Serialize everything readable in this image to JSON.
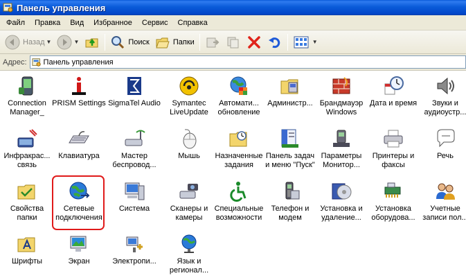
{
  "window": {
    "title": "Панель управления"
  },
  "menu": {
    "items": [
      "Файл",
      "Правка",
      "Вид",
      "Избранное",
      "Сервис",
      "Справка"
    ]
  },
  "toolbar": {
    "back_label": "Назад",
    "search_label": "Поиск",
    "folders_label": "Папки"
  },
  "address": {
    "label": "Адрес:",
    "value": "Панель управления"
  },
  "items": [
    {
      "label": "Connection Manager_",
      "icon": "pda-icon"
    },
    {
      "label": "PRISM Settings",
      "icon": "info-icon"
    },
    {
      "label": "SigmaTel Audio",
      "icon": "sigmatel-icon"
    },
    {
      "label": "Symantec LiveUpdate",
      "icon": "liveupdate-icon"
    },
    {
      "label": "Автомати... обновление",
      "icon": "globe-update-icon"
    },
    {
      "label": "Администр...",
      "icon": "admin-tools-icon"
    },
    {
      "label": "Брандмауэр Windows",
      "icon": "firewall-icon"
    },
    {
      "label": "Дата и время",
      "icon": "clock-icon"
    },
    {
      "label": "Звуки и аудиоустр...",
      "icon": "speaker-icon"
    },
    {
      "label": "Инфракрас... связь",
      "icon": "infrared-icon"
    },
    {
      "label": "Клавиатура",
      "icon": "keyboard-icon"
    },
    {
      "label": "Мастер беспровод...",
      "icon": "wireless-icon"
    },
    {
      "label": "Мышь",
      "icon": "mouse-icon"
    },
    {
      "label": "Назначенные задания",
      "icon": "scheduled-tasks-icon"
    },
    {
      "label": "Панель задач и меню \"Пуск\"",
      "icon": "taskbar-icon"
    },
    {
      "label": "Параметры Монитор...",
      "icon": "phone-modem-icon"
    },
    {
      "label": "Принтеры и факсы",
      "icon": "printer-icon"
    },
    {
      "label": "Речь",
      "icon": "speech-icon"
    },
    {
      "label": "Свойства папки",
      "icon": "folder-options-icon"
    },
    {
      "label": "Сетевые подключения",
      "icon": "network-globe-icon"
    },
    {
      "label": "Система",
      "icon": "system-icon"
    },
    {
      "label": "Сканеры и камеры",
      "icon": "scanner-icon"
    },
    {
      "label": "Специальные возможности",
      "icon": "accessibility-icon"
    },
    {
      "label": "Телефон и модем",
      "icon": "telephone-icon"
    },
    {
      "label": "Установка и удаление...",
      "icon": "add-remove-icon"
    },
    {
      "label": "Установка оборудова...",
      "icon": "hardware-icon"
    },
    {
      "label": "Учетные записи пол...",
      "icon": "users-icon"
    },
    {
      "label": "Шрифты",
      "icon": "fonts-folder-icon"
    },
    {
      "label": "Экран",
      "icon": "display-icon"
    },
    {
      "label": "Электропи...",
      "icon": "power-icon"
    },
    {
      "label": "Язык и регионал...",
      "icon": "language-icon"
    }
  ],
  "colors": {
    "titlebar": "#0a5bd9",
    "chrome": "#ece9d8",
    "highlight": "#e01a1a"
  }
}
